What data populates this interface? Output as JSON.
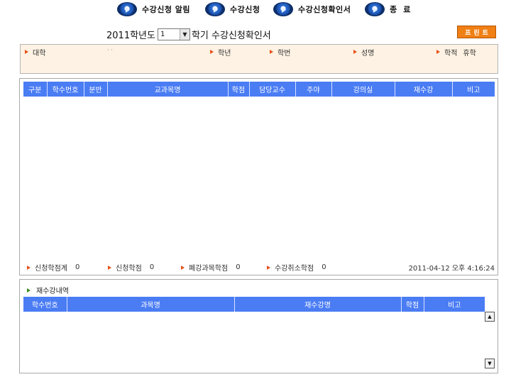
{
  "nav": {
    "items": [
      {
        "label": "수강신청 알림",
        "icon": "arrow-circle-icon"
      },
      {
        "label": "수강신청",
        "icon": "arrow-circle-icon"
      },
      {
        "label": "수강신청확인서",
        "icon": "arrow-circle-icon"
      },
      {
        "label": "종  료",
        "icon": "arrow-circle-icon"
      }
    ]
  },
  "title": {
    "year_label": "2011학년도",
    "semester_value": "1",
    "suffix": "학기 수강신청확인서"
  },
  "print_button": "프린트",
  "student_info": {
    "college_label": "대학",
    "college_value": "· ·",
    "grade_label": "학년",
    "student_no_label": "학번",
    "name_label": "성명",
    "status_label": "학적",
    "status_value": "휴학"
  },
  "course_table": {
    "columns": [
      "구분",
      "학수번호",
      "분반",
      "교과목명",
      "학점",
      "담당교수",
      "주야",
      "강의실",
      "재수강",
      "비고"
    ],
    "rows": []
  },
  "totals": {
    "registered_total_label": "신청학점계",
    "registered_total_value": "0",
    "registered_label": "신청학점",
    "registered_value": "0",
    "closed_label": "폐강과목학점",
    "closed_value": "0",
    "cancelled_label": "수강취소학점",
    "cancelled_value": "0",
    "timestamp": "2011-04-12 오후 4:16:24"
  },
  "retake": {
    "title": "재수강내역",
    "columns": [
      "학수번호",
      "과목명",
      "재수강명",
      "학점",
      "비고"
    ],
    "rows": []
  },
  "colors": {
    "header_blue": "#4a7cf4",
    "print_orange": "#f07f14",
    "info_bg": "#fdf2e3"
  }
}
